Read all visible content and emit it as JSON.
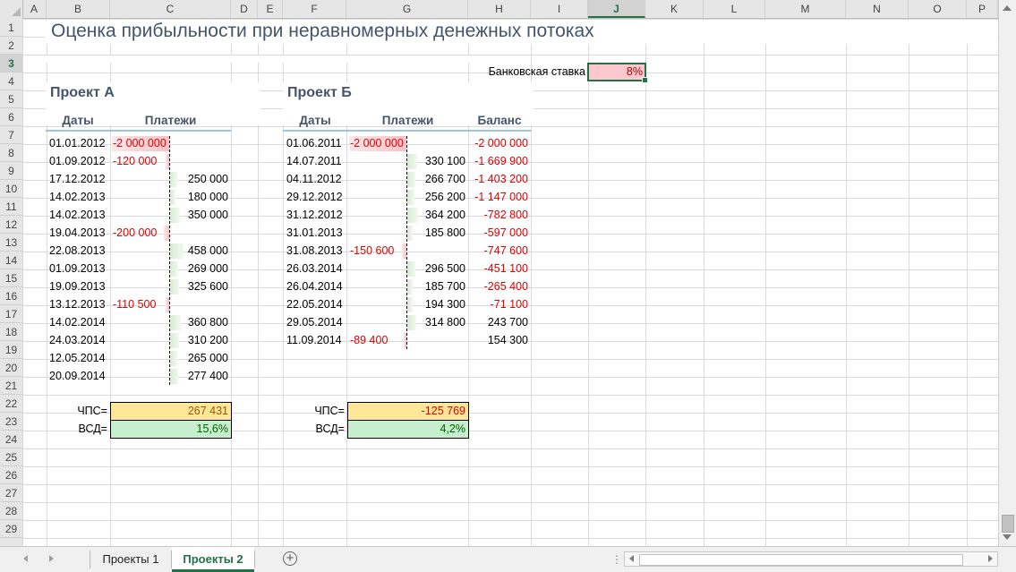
{
  "columns": [
    "A",
    "B",
    "C",
    "D",
    "E",
    "F",
    "G",
    "H",
    "I",
    "J",
    "K",
    "L",
    "M",
    "N",
    "O",
    "P"
  ],
  "rows": [
    "1",
    "2",
    "3",
    "4",
    "5",
    "6",
    "7",
    "8",
    "9",
    "10",
    "11",
    "12",
    "13",
    "14",
    "15",
    "16",
    "17",
    "18",
    "19",
    "20",
    "21",
    "22",
    "23",
    "24",
    "25",
    "26",
    "27",
    "28",
    "29"
  ],
  "active_column": "J",
  "active_row": "3",
  "title": "Оценка прибыльности при неравномерных денежных потоках",
  "bank_rate": {
    "label": "Банковская ставка",
    "value": "8%"
  },
  "project_a": {
    "heading": "Проект А",
    "col_dates": "Даты",
    "col_payments": "Платежи",
    "rows": [
      {
        "date": "01.01.2012",
        "payment": "-2 000 000",
        "value": -2000000
      },
      {
        "date": "01.09.2012",
        "payment": "-120 000",
        "value": -120000
      },
      {
        "date": "17.12.2012",
        "payment": "250 000",
        "value": 250000
      },
      {
        "date": "14.02.2013",
        "payment": "180 000",
        "value": 180000
      },
      {
        "date": "14.02.2013",
        "payment": "350 000",
        "value": 350000
      },
      {
        "date": "19.04.2013",
        "payment": "-200 000",
        "value": -200000
      },
      {
        "date": "22.08.2013",
        "payment": "458 000",
        "value": 458000
      },
      {
        "date": "01.09.2013",
        "payment": "269 000",
        "value": 269000
      },
      {
        "date": "19.09.2013",
        "payment": "325 600",
        "value": 325600
      },
      {
        "date": "13.12.2013",
        "payment": "-110 500",
        "value": -110500
      },
      {
        "date": "14.02.2014",
        "payment": "360 800",
        "value": 360800
      },
      {
        "date": "24.03.2014",
        "payment": "310 200",
        "value": 310200
      },
      {
        "date": "12.05.2014",
        "payment": "265 000",
        "value": 265000
      },
      {
        "date": "20.09.2014",
        "payment": "277 400",
        "value": 277400
      }
    ],
    "npv_label": "ЧПС=",
    "npv_value": "267 431",
    "irr_label": "ВСД=",
    "irr_value": "15,6%"
  },
  "project_b": {
    "heading": "Проект Б",
    "col_dates": "Даты",
    "col_payments": "Платежи",
    "col_balance": "Баланс",
    "rows": [
      {
        "date": "01.06.2011",
        "payment": "-2 000 000",
        "value": -2000000,
        "balance": "-2 000 000",
        "balance_negative": true
      },
      {
        "date": "14.07.2011",
        "payment": "330 100",
        "value": 330100,
        "balance": "-1 669 900",
        "balance_negative": true
      },
      {
        "date": "04.11.2012",
        "payment": "266 700",
        "value": 266700,
        "balance": "-1 403 200",
        "balance_negative": true
      },
      {
        "date": "29.12.2012",
        "payment": "256 200",
        "value": 256200,
        "balance": "-1 147 000",
        "balance_negative": true
      },
      {
        "date": "31.12.2012",
        "payment": "364 200",
        "value": 364200,
        "balance": "-782 800",
        "balance_negative": true
      },
      {
        "date": "31.01.2013",
        "payment": "185 800",
        "value": 185800,
        "balance": "-597 000",
        "balance_negative": true
      },
      {
        "date": "31.08.2013",
        "payment": "-150 600",
        "value": -150600,
        "balance": "-747 600",
        "balance_negative": true
      },
      {
        "date": "26.03.2014",
        "payment": "296 500",
        "value": 296500,
        "balance": "-451 100",
        "balance_negative": true
      },
      {
        "date": "26.04.2014",
        "payment": "185 700",
        "value": 185700,
        "balance": "-265 400",
        "balance_negative": true
      },
      {
        "date": "22.05.2014",
        "payment": "194 300",
        "value": 194300,
        "balance": "-71 100",
        "balance_negative": true
      },
      {
        "date": "29.05.2014",
        "payment": "314 800",
        "value": 314800,
        "balance": "243 700",
        "balance_negative": false
      },
      {
        "date": "11.09.2014",
        "payment": "-89 400",
        "value": -89400,
        "balance": "154 300",
        "balance_negative": false
      }
    ],
    "npv_label": "ЧПС=",
    "npv_value": "-125 769",
    "irr_label": "ВСД=",
    "irr_value": "4,2%"
  },
  "colors": {
    "title": "#44546a",
    "negative": "#e00000",
    "npv_fill": "#ffe699",
    "irr_fill": "#c6efce",
    "rate_fill": "#ffc7ce",
    "accent": "#217346"
  },
  "sheet_tabs": [
    {
      "label": "Проекты 1",
      "active": false
    },
    {
      "label": "Проекты 2",
      "active": true
    }
  ],
  "icons": {
    "add_sheet": "plus-circle-icon",
    "nav_prev": "triangle-left-icon",
    "nav_next": "triangle-right-icon"
  }
}
